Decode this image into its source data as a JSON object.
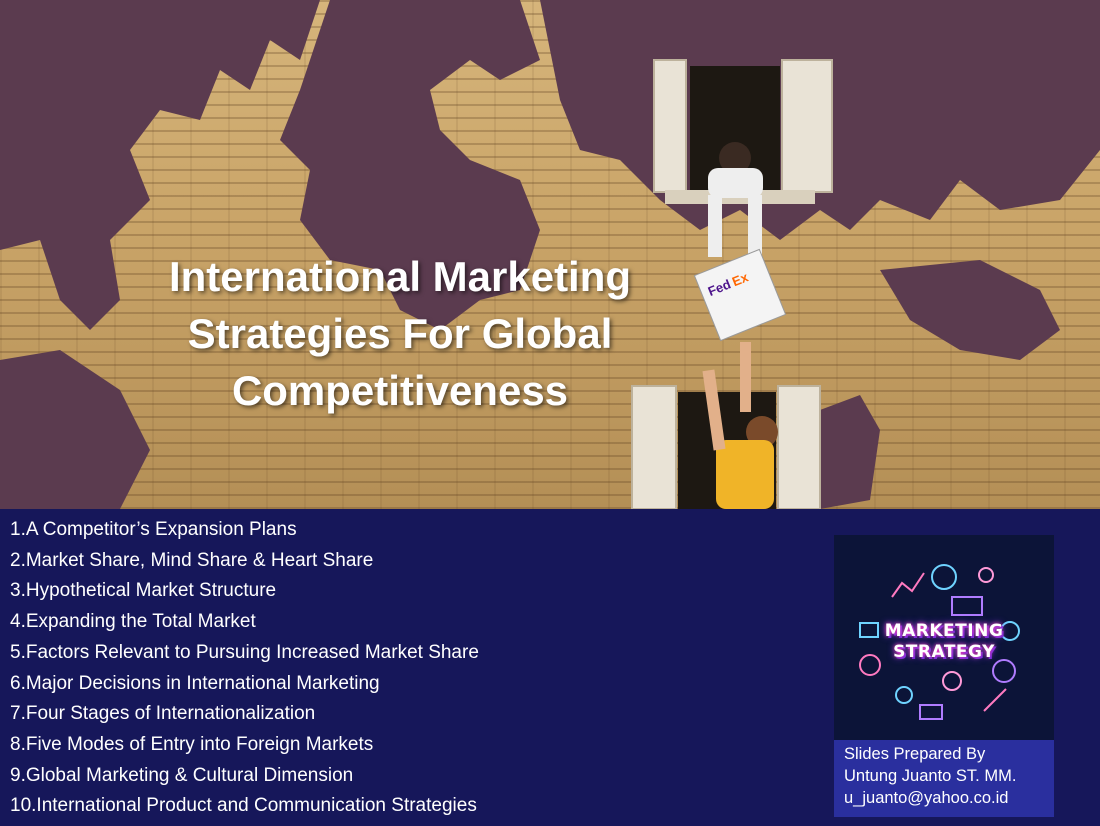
{
  "slide": {
    "title": "International Marketing Strategies For Global Competitiveness",
    "topics": [
      "1.A Competitor’s Expansion Plans",
      "2.Market Share, Mind Share & Heart Share",
      "3.Hypothetical Market Structure",
      "4.Expanding the Total Market",
      "5.Factors Relevant to Pursuing Increased Market Share",
      "6.Major Decisions in International Marketing",
      "7.Four Stages of Internationalization",
      "8.Five Modes of Entry into Foreign Markets",
      "9.Global Marketing & Cultural Dimension",
      "10.International Product and Communication Strategies"
    ],
    "badge": {
      "line1": "MARKETING",
      "line2": "STRATEGY"
    },
    "credits": {
      "line1": "Slides Prepared By",
      "line2": "Untung Juanto ST. MM.",
      "line3": "u_juanto@yahoo.co.id"
    },
    "colors": {
      "panel_bg": "#16175a",
      "credit_bg": "#2a2f9e",
      "map_land": "#5b3b4f",
      "wall": "#c8a56b"
    },
    "icons": [
      "courier-box-icon",
      "marketing-strategy-badge-icon"
    ]
  }
}
